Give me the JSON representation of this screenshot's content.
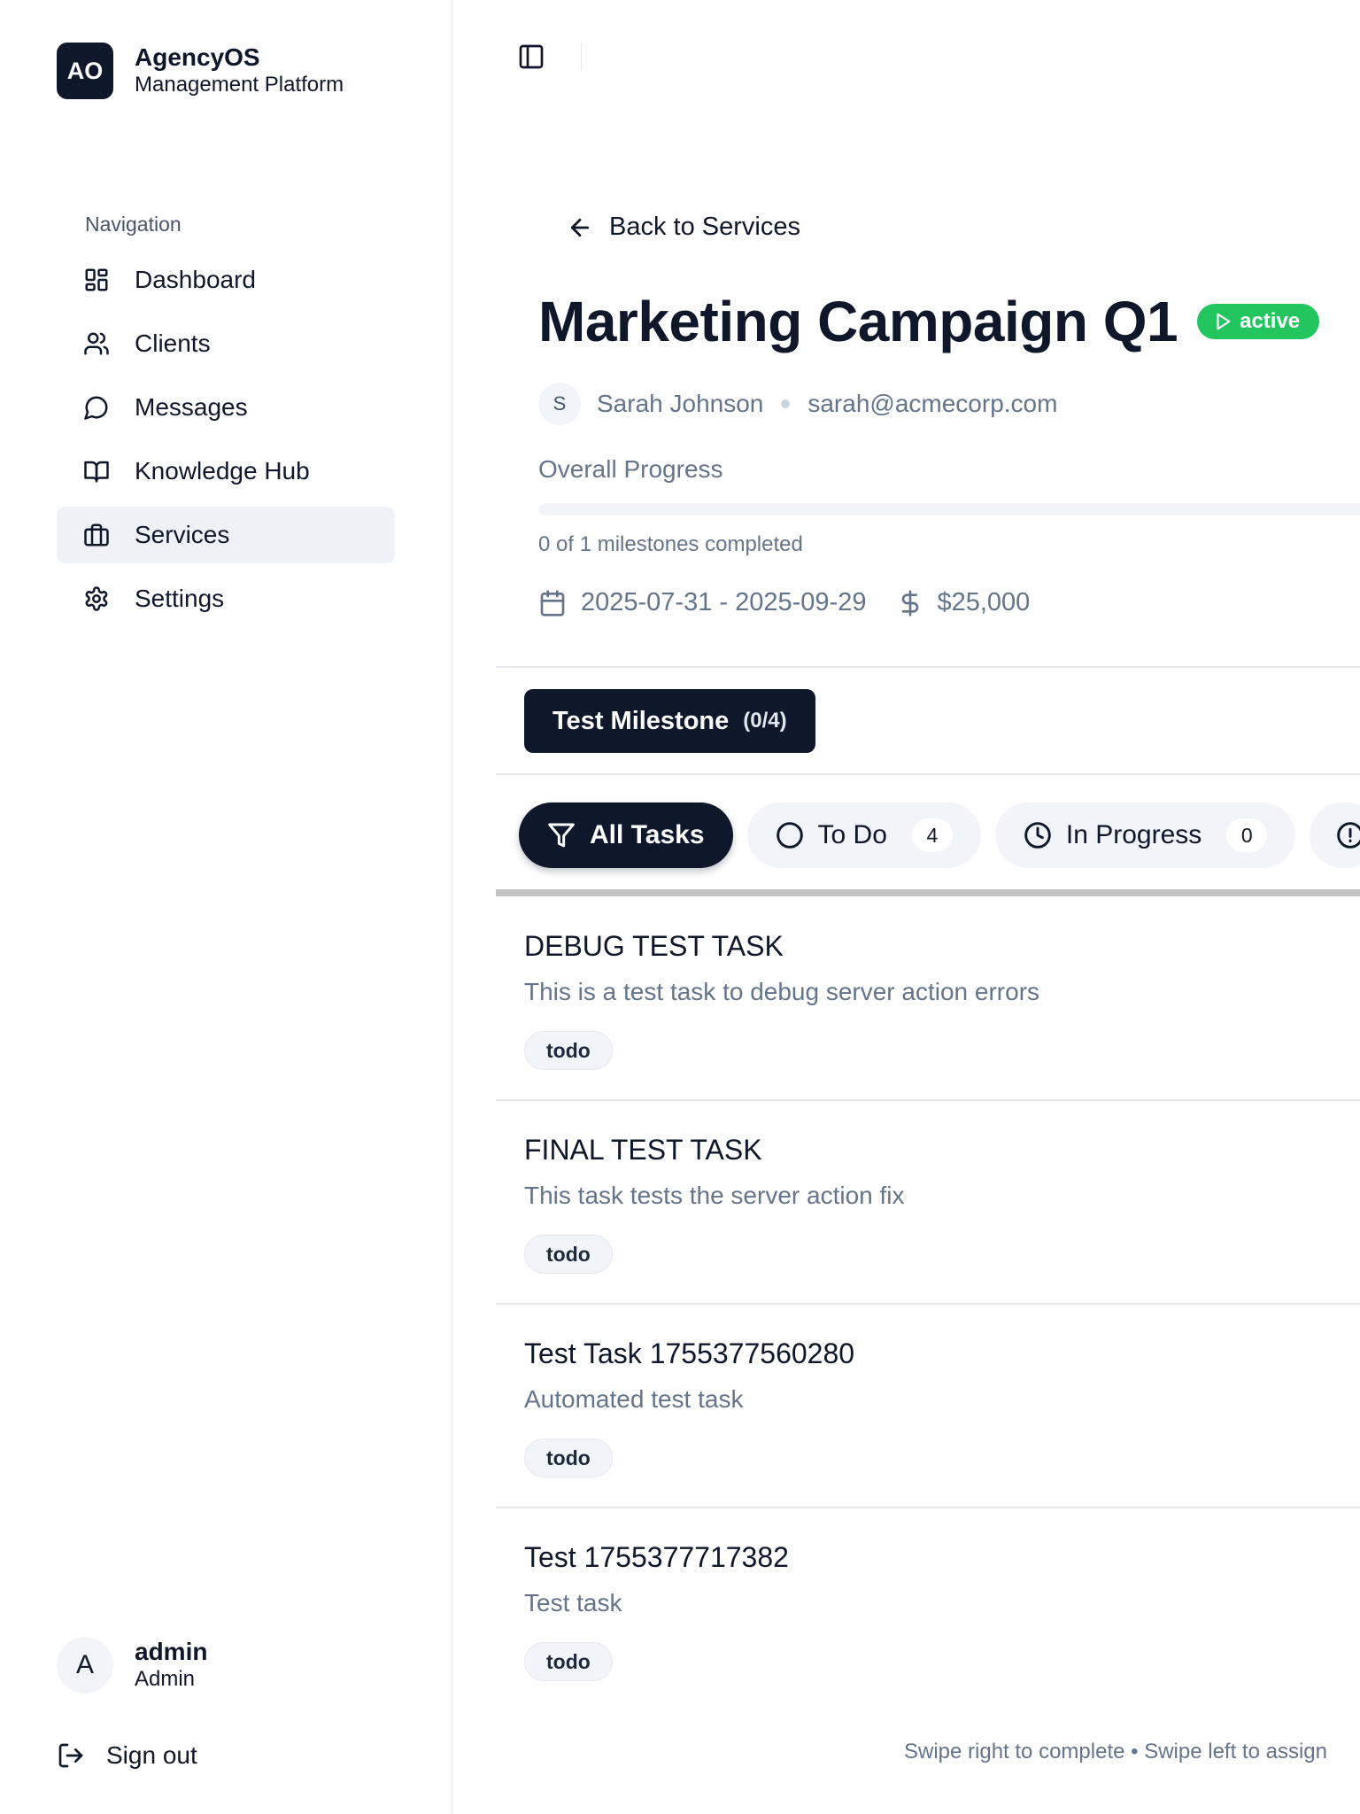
{
  "brand": {
    "logo": "AO",
    "name": "AgencyOS",
    "subtitle": "Management Platform"
  },
  "sidebar": {
    "heading": "Navigation",
    "items": [
      {
        "label": "Dashboard",
        "icon": "dashboard-icon"
      },
      {
        "label": "Clients",
        "icon": "users-icon"
      },
      {
        "label": "Messages",
        "icon": "message-icon"
      },
      {
        "label": "Knowledge Hub",
        "icon": "book-icon"
      },
      {
        "label": "Services",
        "icon": "briefcase-icon",
        "active": true
      },
      {
        "label": "Settings",
        "icon": "gear-icon"
      }
    ],
    "user": {
      "initial": "A",
      "name": "admin",
      "role": "Admin"
    },
    "signout": "Sign out"
  },
  "main": {
    "back_label": "Back to Services",
    "title": "Marketing Campaign Q1",
    "status": "active",
    "contact": {
      "initial": "S",
      "name": "Sarah Johnson",
      "email": "sarah@acmecorp.com"
    },
    "progress": {
      "label": "Overall Progress",
      "value": 0,
      "milestones_text": "0 of 1 milestones completed"
    },
    "dates": "2025-07-31 - 2025-09-29",
    "budget": "$25,000",
    "milestone": {
      "name": "Test Milestone",
      "count": "(0/4)"
    },
    "filters": [
      {
        "label": "All Tasks",
        "icon": "filter-icon",
        "active": true
      },
      {
        "label": "To Do",
        "icon": "circle-icon",
        "count": "4"
      },
      {
        "label": "In Progress",
        "icon": "clock-icon",
        "count": "0"
      },
      {
        "label": "",
        "icon": "alert-circle-icon"
      }
    ],
    "tasks": [
      {
        "title": "DEBUG TEST TASK",
        "description": "This is a test task to debug server action errors",
        "status": "todo"
      },
      {
        "title": "FINAL TEST TASK",
        "description": "This task tests the server action fix",
        "status": "todo"
      },
      {
        "title": "Test Task 1755377560280",
        "description": "Automated test task",
        "status": "todo"
      },
      {
        "title": "Test 1755377717382",
        "description": "Test task",
        "status": "todo"
      }
    ],
    "hint": "Swipe right to complete • Swipe left to assign"
  },
  "colors": {
    "primary": "#0f172a",
    "active_badge": "#22c55e",
    "muted_text": "#64748b",
    "nav_active_bg": "#eef2f7"
  }
}
